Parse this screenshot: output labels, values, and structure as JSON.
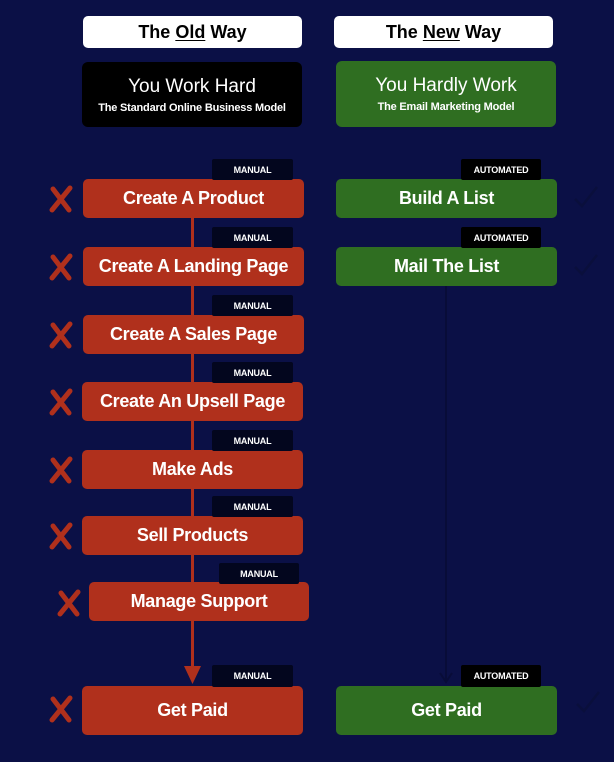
{
  "old_way": {
    "header_prefix": "The ",
    "header_underlined": "Old",
    "header_suffix": " Way",
    "model_title": "You Work Hard",
    "model_subtitle": "The Standard Online Business Model",
    "box_color": "#000000",
    "tag_label": "MANUAL",
    "status_icon": "x-mark-icon",
    "step_color": "#b0301c",
    "steps": [
      {
        "label": "Create A Product",
        "tag": "MANUAL"
      },
      {
        "label": "Create A Landing Page",
        "tag": "MANUAL"
      },
      {
        "label": "Create A Sales Page",
        "tag": "MANUAL"
      },
      {
        "label": "Create An Upsell Page",
        "tag": "MANUAL"
      },
      {
        "label": "Make Ads",
        "tag": "MANUAL"
      },
      {
        "label": "Sell Products",
        "tag": "MANUAL"
      },
      {
        "label": "Manage Support",
        "tag": "MANUAL"
      },
      {
        "label": "Get Paid",
        "tag": "MANUAL"
      }
    ]
  },
  "new_way": {
    "header_prefix": "The ",
    "header_underlined": "New",
    "header_suffix": " Way",
    "model_title": "You Hardly Work",
    "model_subtitle": "The Email Marketing Model",
    "box_color": "#2f6e21",
    "tag_label": "AUTOMATED",
    "status_icon": "check-mark-icon",
    "step_color": "#2f6e21",
    "steps": [
      {
        "label": "Build A List",
        "tag": "AUTOMATED"
      },
      {
        "label": "Mail The List",
        "tag": "AUTOMATED"
      },
      {
        "label": "Get Paid",
        "tag": "AUTOMATED"
      }
    ]
  },
  "colors": {
    "background": "#0b1046",
    "manual_red": "#b0301c",
    "automated_green": "#2f6e21",
    "tag_bg": "#03061e"
  }
}
